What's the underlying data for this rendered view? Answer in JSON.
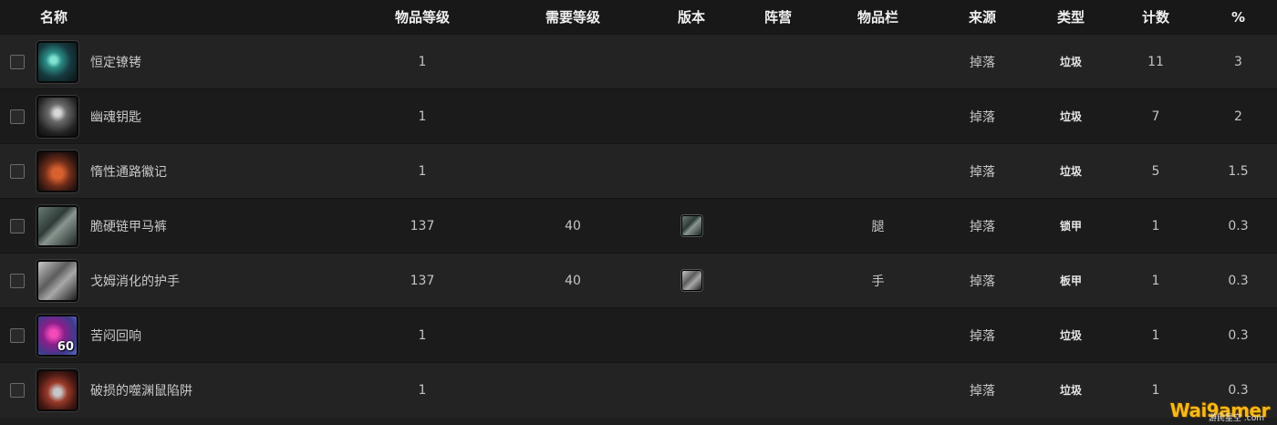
{
  "headers": {
    "name": "名称",
    "item_level": "物品等级",
    "req_level": "需要等级",
    "version": "版本",
    "faction": "阵营",
    "slot": "物品栏",
    "source": "来源",
    "type": "类型",
    "count": "计数",
    "percent": "%"
  },
  "rows": [
    {
      "icon": "cracked-crystal-chain-icon",
      "name": "恒定镣铐",
      "item_level": "1",
      "req_level": "",
      "version_icon": "",
      "faction": "",
      "slot": "",
      "source": "掉落",
      "type": "垃圾",
      "count": "11",
      "percent": "3"
    },
    {
      "icon": "skeleton-key-icon",
      "name": "幽魂钥匙",
      "item_level": "1",
      "req_level": "",
      "version_icon": "",
      "faction": "",
      "slot": "",
      "source": "掉落",
      "type": "垃圾",
      "count": "7",
      "percent": "2"
    },
    {
      "icon": "red-stone-insignia-icon",
      "name": "惰性通路徽记",
      "item_level": "1",
      "req_level": "",
      "version_icon": "",
      "faction": "",
      "slot": "",
      "source": "掉落",
      "type": "垃圾",
      "count": "5",
      "percent": "1.5"
    },
    {
      "icon": "chainmail-leggings-icon",
      "name": "脆硬链甲马裤",
      "item_level": "137",
      "req_level": "40",
      "version_icon": "chainmail-leggings-icon",
      "faction": "",
      "slot": "腿",
      "source": "掉落",
      "type": "锁甲",
      "count": "1",
      "percent": "0.3"
    },
    {
      "icon": "plate-gauntlet-icon",
      "name": "戈姆消化的护手",
      "item_level": "137",
      "req_level": "40",
      "version_icon": "plate-gauntlet-icon",
      "faction": "",
      "slot": "手",
      "source": "掉落",
      "type": "板甲",
      "count": "1",
      "percent": "0.3"
    },
    {
      "icon": "purple-swirl-echo-icon",
      "name": "苦闷回响",
      "item_level": "1",
      "req_level": "",
      "version_icon": "",
      "faction": "",
      "slot": "",
      "source": "掉落",
      "type": "垃圾",
      "count": "1",
      "percent": "0.3",
      "icon_badge": "60"
    },
    {
      "icon": "broken-rat-trap-icon",
      "name": "破损的噬渊鼠陷阱",
      "item_level": "1",
      "req_level": "",
      "version_icon": "",
      "faction": "",
      "slot": "",
      "source": "掉落",
      "type": "垃圾",
      "count": "1",
      "percent": "0.3"
    }
  ],
  "colors": {
    "background": "#1e1e1e",
    "header_text": "#f0f0f0",
    "cell_text": "#c4c4c4",
    "watermark": "#f5b81d"
  },
  "watermark": {
    "text": "Wai9amer",
    "sub": "游民星空 .com"
  }
}
